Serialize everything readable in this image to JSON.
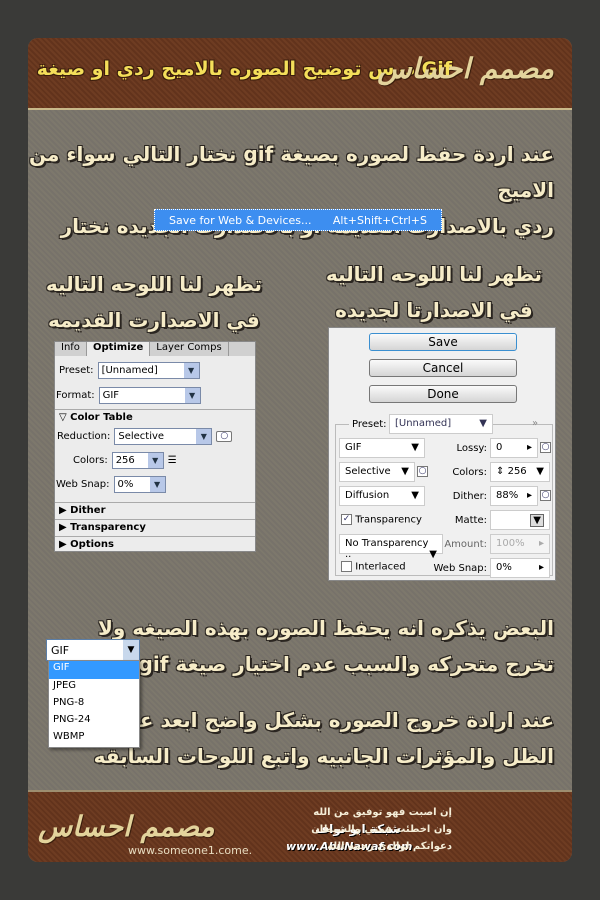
{
  "header": {
    "title": "درس توضيح الصوره بالاميج ردي او صيغة Gif",
    "logo": "مصمم احساس"
  },
  "intro": [
    "عند اردة حفظ لصوره بصيغة gif نختار التالي سواء من الاميج",
    "ردي بالاصدارت القديمه او بالاصدارت الجديده نختار"
  ],
  "menu": {
    "label": "Save for Web & Devices...",
    "shortcut": "Alt+Shift+Ctrl+S"
  },
  "caption_new": [
    "تظهر لنا اللوحه التاليه",
    "في الاصدارتا لجديده"
  ],
  "caption_old": [
    "تظهر لنا اللوحه التاليه",
    "في الاصدارت القديمه"
  ],
  "old_panel": {
    "tabs": [
      "Info",
      "Optimize",
      "Layer Comps"
    ],
    "preset_label": "Preset:",
    "preset": "[Unnamed]",
    "format_label": "Format:",
    "format": "GIF",
    "color_table": "Color Table",
    "reduction_label": "Reduction:",
    "reduction": "Selective",
    "colors_label": "Colors:",
    "colors": "256",
    "websnap_label": "Web Snap:",
    "websnap": "0%",
    "sections": [
      "Dither",
      "Transparency",
      "Options"
    ]
  },
  "new_panel": {
    "buttons": [
      "Save",
      "Cancel",
      "Done"
    ],
    "preset_label": "Preset:",
    "preset": "[Unnamed]",
    "format": "GIF",
    "reduction": "Selective",
    "dither_algo": "Diffusion",
    "transparency_label": "Transparency",
    "transparency_checked": true,
    "transparency_dither": "No Transparency ..",
    "interlaced_label": "Interlaced",
    "interlaced_checked": false,
    "lossy_label": "Lossy:",
    "lossy": "0",
    "colors_label": "Colors:",
    "colors": "256",
    "dither_label": "Dither:",
    "dither": "88%",
    "matte_label": "Matte:",
    "amount_label": "Amount:",
    "amount": "100%",
    "websnap_label": "Web Snap:",
    "websnap": "0%"
  },
  "format_dropdown": {
    "selected": "GIF",
    "options": [
      "GIF",
      "JPEG",
      "PNG-8",
      "PNG-24",
      "WBMP"
    ]
  },
  "note1": [
    "البعض يذكره انه يحفظ الصوره بهذه الصيغه ولا",
    "تخرج متحركه والسبب عدم اختيار صيغة gif"
  ],
  "note2": [
    "عند ارادة خروج الصوره بشكل واضح ابعد عن وضع",
    "الظل والمؤثرات الجانبيه واتبع اللوحات السابقه"
  ],
  "footer": {
    "site1": "www.someone1.come.",
    "network": "شبكة ابو نواف",
    "site2": "www.AbuNawaf.com",
    "dua": [
      "إن اصبت فهو توفيق من الله",
      "وان اخطئت فمني والشيطان",
      "دعواتكم لوالدي رحمه الله"
    ],
    "logo": "مصمم احساس"
  }
}
